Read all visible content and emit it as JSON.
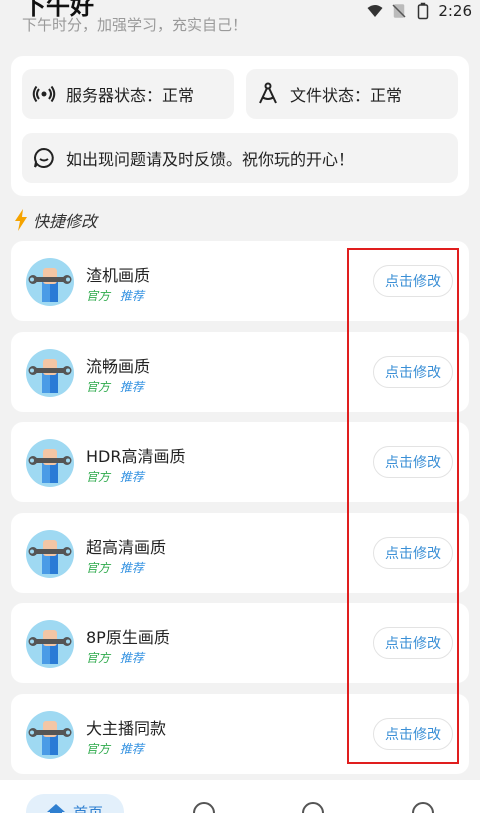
{
  "status_bar": {
    "time": "2:26"
  },
  "header": {
    "title": "下午好",
    "subtitle": "下午时分，加强学习，充实自己！"
  },
  "status_cards": {
    "server_status": "服务器状态：正常",
    "file_status": "文件状态：正常",
    "notice": "如出现问题请及时反馈。祝你玩的开心！"
  },
  "quick_section": {
    "title": "快捷修改"
  },
  "items": [
    {
      "title": "渣机画质",
      "tag_official": "官方",
      "tag_recommend": "推荐",
      "button": "点击修改"
    },
    {
      "title": "流畅画质",
      "tag_official": "官方",
      "tag_recommend": "推荐",
      "button": "点击修改"
    },
    {
      "title": "HDR高清画质",
      "tag_official": "官方",
      "tag_recommend": "推荐",
      "button": "点击修改"
    },
    {
      "title": "超高清画质",
      "tag_official": "官方",
      "tag_recommend": "推荐",
      "button": "点击修改"
    },
    {
      "title": "8P原生画质",
      "tag_official": "官方",
      "tag_recommend": "推荐",
      "button": "点击修改"
    },
    {
      "title": "大主播同款",
      "tag_official": "官方",
      "tag_recommend": "推荐",
      "button": "点击修改"
    }
  ],
  "bottom_nav": {
    "home_label": "首页"
  },
  "colors": {
    "accent": "#3a8fd6",
    "highlight": "#e01e1e",
    "tag_green": "#2eaa4c"
  }
}
